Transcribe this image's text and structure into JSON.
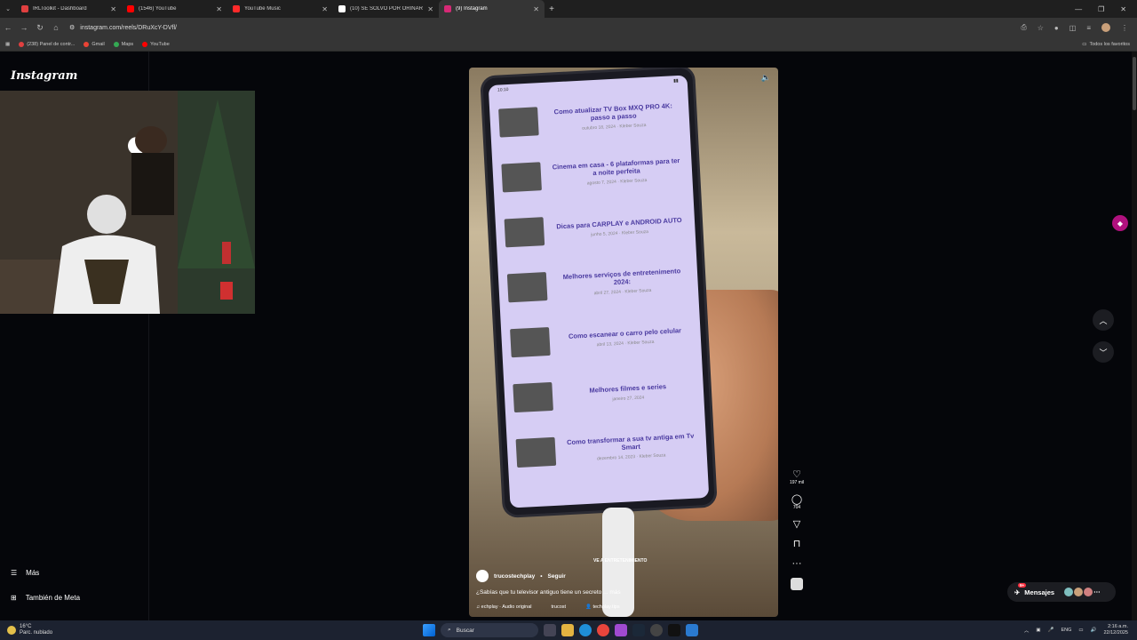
{
  "browser": {
    "tabs": [
      {
        "title": "IRLToolkit - Dashboard",
        "color": "#e04040",
        "active": false
      },
      {
        "title": "(1546) YouTube",
        "color": "#ff0000",
        "active": false
      },
      {
        "title": "YouTube Music",
        "color": "#ff2a2a",
        "active": false
      },
      {
        "title": "(10) SE SOLVO POR ORINAR - X",
        "color": "#ffffff",
        "active": false
      },
      {
        "title": "(9) Instagram",
        "color": "#d62976",
        "active": true
      }
    ],
    "url": "instagram.com/reels/DRuXcY-DVfl/",
    "bookmarks": [
      {
        "label": "(238) Panel de contr...",
        "color": "#e04040"
      },
      {
        "label": "Gmail",
        "color": "#ea4335"
      },
      {
        "label": "Maps",
        "color": "#34a853"
      },
      {
        "label": "YouTube",
        "color": "#ff0000"
      }
    ],
    "all_bookmarks_label": "Todos los favoritos"
  },
  "sidebar": {
    "logo": "Instagram",
    "more_label": "Más",
    "meta_label": "También de Meta"
  },
  "reel": {
    "articles": [
      {
        "title": "Como atualizar TV Box MXQ PRO 4K: passo a passo",
        "meta": "outubro 18, 2024 · Kleber Souza"
      },
      {
        "title": "Cinema em casa - 6 plataformas para ter a noite perfeita",
        "meta": "agosto 7, 2024 · Kleber Souza"
      },
      {
        "title": "Dicas para CARPLAY e ANDROID AUTO",
        "meta": "junho 5, 2024 · Kleber Souza"
      },
      {
        "title": "Melhores serviços de entretenimento 2024:",
        "meta": "abril 27, 2024 · Kleber Souza"
      },
      {
        "title": "Como escanear o carro pelo celular",
        "meta": "abril 13, 2024 · Kleber Souza"
      },
      {
        "title": "Melhores filmes e series",
        "meta": "janeiro 27, 2024"
      },
      {
        "title": "Como transformar a sua tv antiga em Tv Smart",
        "meta": "dezembro 14, 2023 · Kleber Souza"
      }
    ],
    "username": "trucostechplay",
    "follow_label": "Seguir",
    "caption": "¿Sabías que tu televisor antiguo tiene un secreto ... más",
    "audio": "echplay · Audio original",
    "tag1": "trucost",
    "tag2": "techplay.tips",
    "overlay_text": "VE A ENTRETENIMIENTO",
    "likes": "197 mil",
    "comments": "704"
  },
  "messages": {
    "label": "Mensajes",
    "badge": "9+"
  },
  "taskbar": {
    "temperature": "16°C",
    "weather": "Parc. nublado",
    "search_placeholder": "Buscar",
    "lang": "ENG",
    "time": "2:16 a.m.",
    "date": "22/12/2025"
  }
}
